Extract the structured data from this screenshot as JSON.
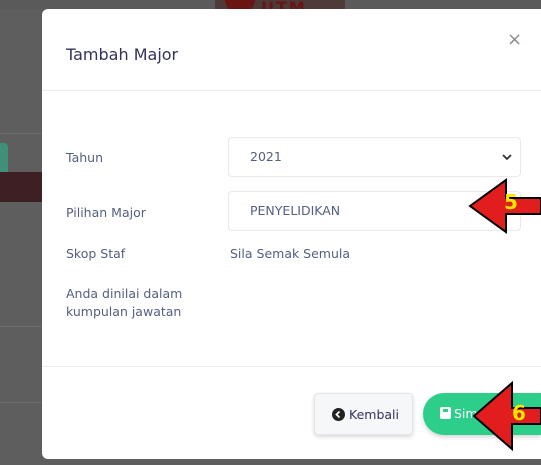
{
  "background": {
    "logo_text": "UTM"
  },
  "modal": {
    "title": "Tambah Major",
    "close_symbol": "×",
    "fields": {
      "tahun_label": "Tahun",
      "tahun_value": "2021",
      "major_label": "Pilihan Major",
      "major_value": "PENYELIDIKAN",
      "skop_label": "Skop Staf",
      "skop_value": "Sila Semak Semula",
      "kumpulan_label": "Anda dinilai dalam kumpulan jawatan"
    },
    "footer": {
      "back_label": "Kembali",
      "save_label": "Simp"
    }
  },
  "annotations": {
    "step_a": "5",
    "step_b": "6",
    "arrow_color": "#e11d1d",
    "step_color": "#ffe600"
  },
  "colors": {
    "success": "#2dce89",
    "text": "#525f7f",
    "title": "#32325d"
  }
}
